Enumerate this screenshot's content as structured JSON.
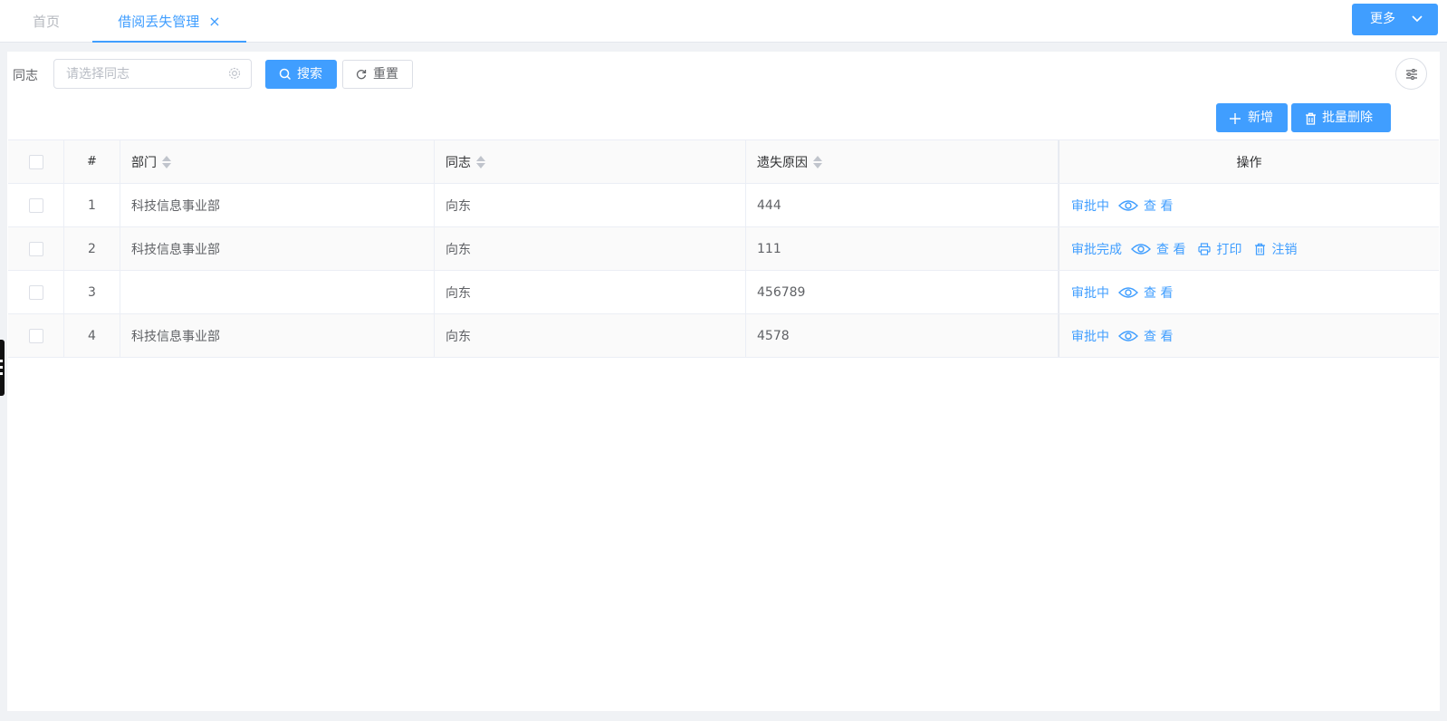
{
  "tabs": [
    {
      "label": "首页",
      "active": false
    },
    {
      "label": "借阅丢失管理",
      "active": true,
      "closable": true
    }
  ],
  "header": {
    "more_label": "更多"
  },
  "filter": {
    "label": "同志",
    "placeholder": "请选择同志",
    "search_label": "搜索",
    "reset_label": "重置"
  },
  "toolbar": {
    "add_label": "新增",
    "batch_delete_label": "批量删除"
  },
  "table": {
    "columns": [
      "#",
      "部门",
      "同志",
      "遗失原因",
      "操作"
    ],
    "rows": [
      {
        "index": "1",
        "dept": "科技信息事业部",
        "name": "向东",
        "reason": "444",
        "status": "审批中",
        "view": "查 看"
      },
      {
        "index": "2",
        "dept": "科技信息事业部",
        "name": "向东",
        "reason": "111",
        "status": "审批完成",
        "view": "查 看",
        "print": "打印",
        "cancel": "注销"
      },
      {
        "index": "3",
        "dept": "",
        "name": "向东",
        "reason": "456789",
        "status": "审批中",
        "view": "查 看"
      },
      {
        "index": "4",
        "dept": "科技信息事业部",
        "name": "向东",
        "reason": "4578",
        "status": "审批中",
        "view": "查 看"
      }
    ]
  },
  "colors": {
    "primary": "#409eff",
    "border": "#ebeef5",
    "text": "#606266"
  }
}
